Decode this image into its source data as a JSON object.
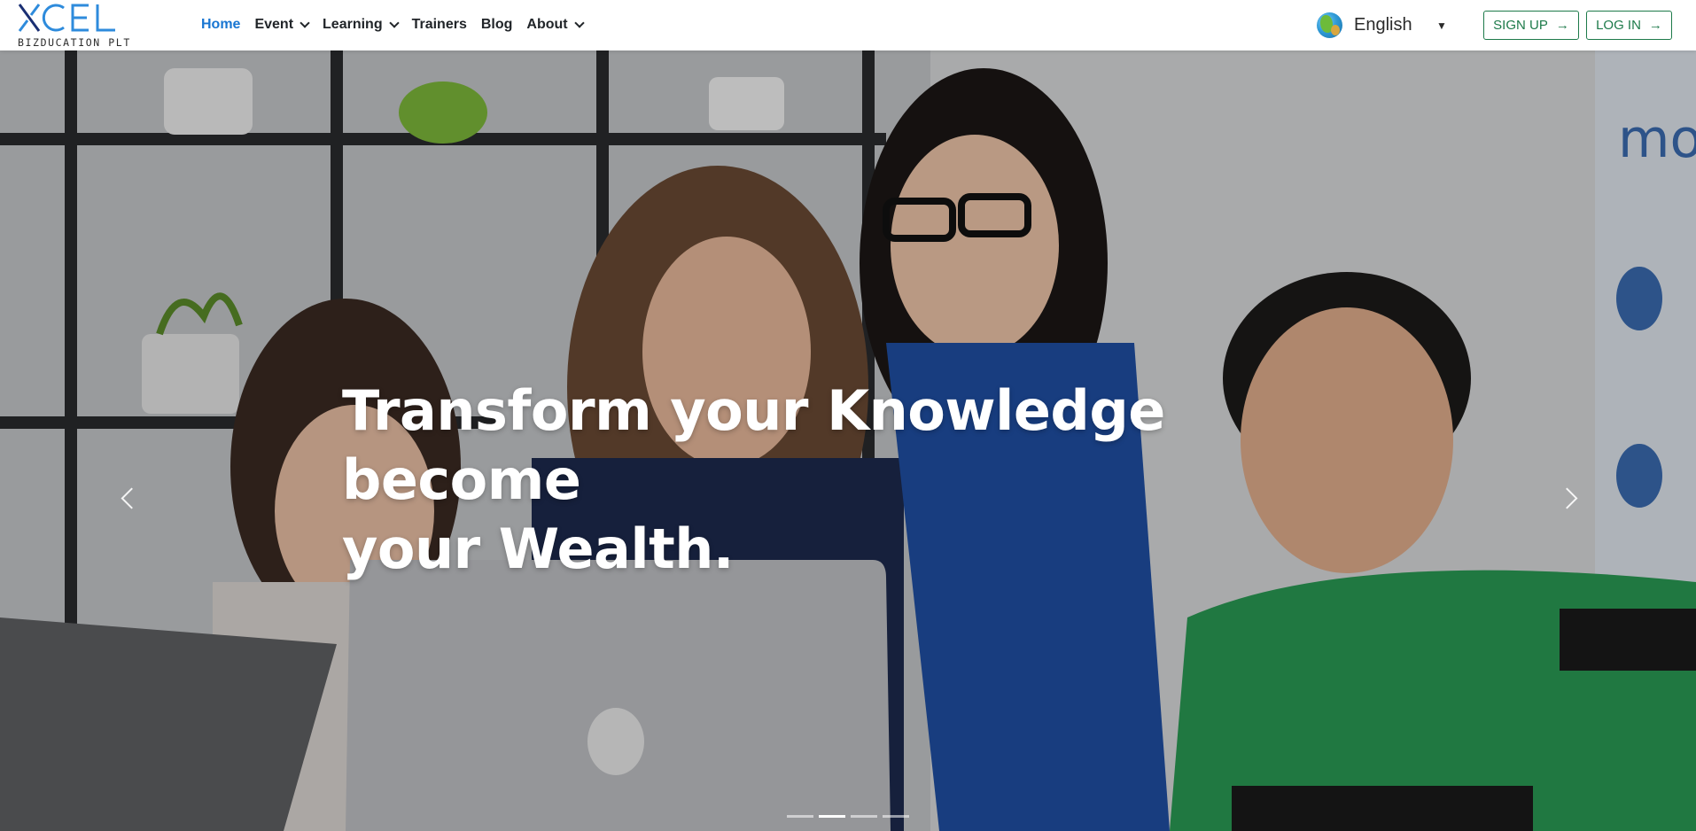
{
  "brand": {
    "name": "XCEL",
    "tagline": "BIZDUCATION PLT",
    "logo_colors": [
      "#1a2f73",
      "#2e8bdc"
    ]
  },
  "nav": {
    "items": [
      {
        "label": "Home",
        "active": true,
        "dropdown": false
      },
      {
        "label": "Event",
        "active": false,
        "dropdown": true
      },
      {
        "label": "Learning",
        "active": false,
        "dropdown": true
      },
      {
        "label": "Trainers",
        "active": false,
        "dropdown": false
      },
      {
        "label": "Blog",
        "active": false,
        "dropdown": false
      },
      {
        "label": "About",
        "active": false,
        "dropdown": true
      }
    ],
    "active_color": "#1976d2"
  },
  "language": {
    "selected": "English",
    "icon": "globe-icon"
  },
  "auth": {
    "signup_label": "SIGN UP",
    "login_label": "LOG IN",
    "accent": "#1d7a4a",
    "icon": "arrow-right-icon"
  },
  "hero": {
    "headline_line1": "Transform your Knowledge become",
    "headline_line2": "your Wealth.",
    "slide_count": 4,
    "active_slide": 2,
    "prev_icon": "chevron-left-icon",
    "next_icon": "chevron-right-icon"
  }
}
